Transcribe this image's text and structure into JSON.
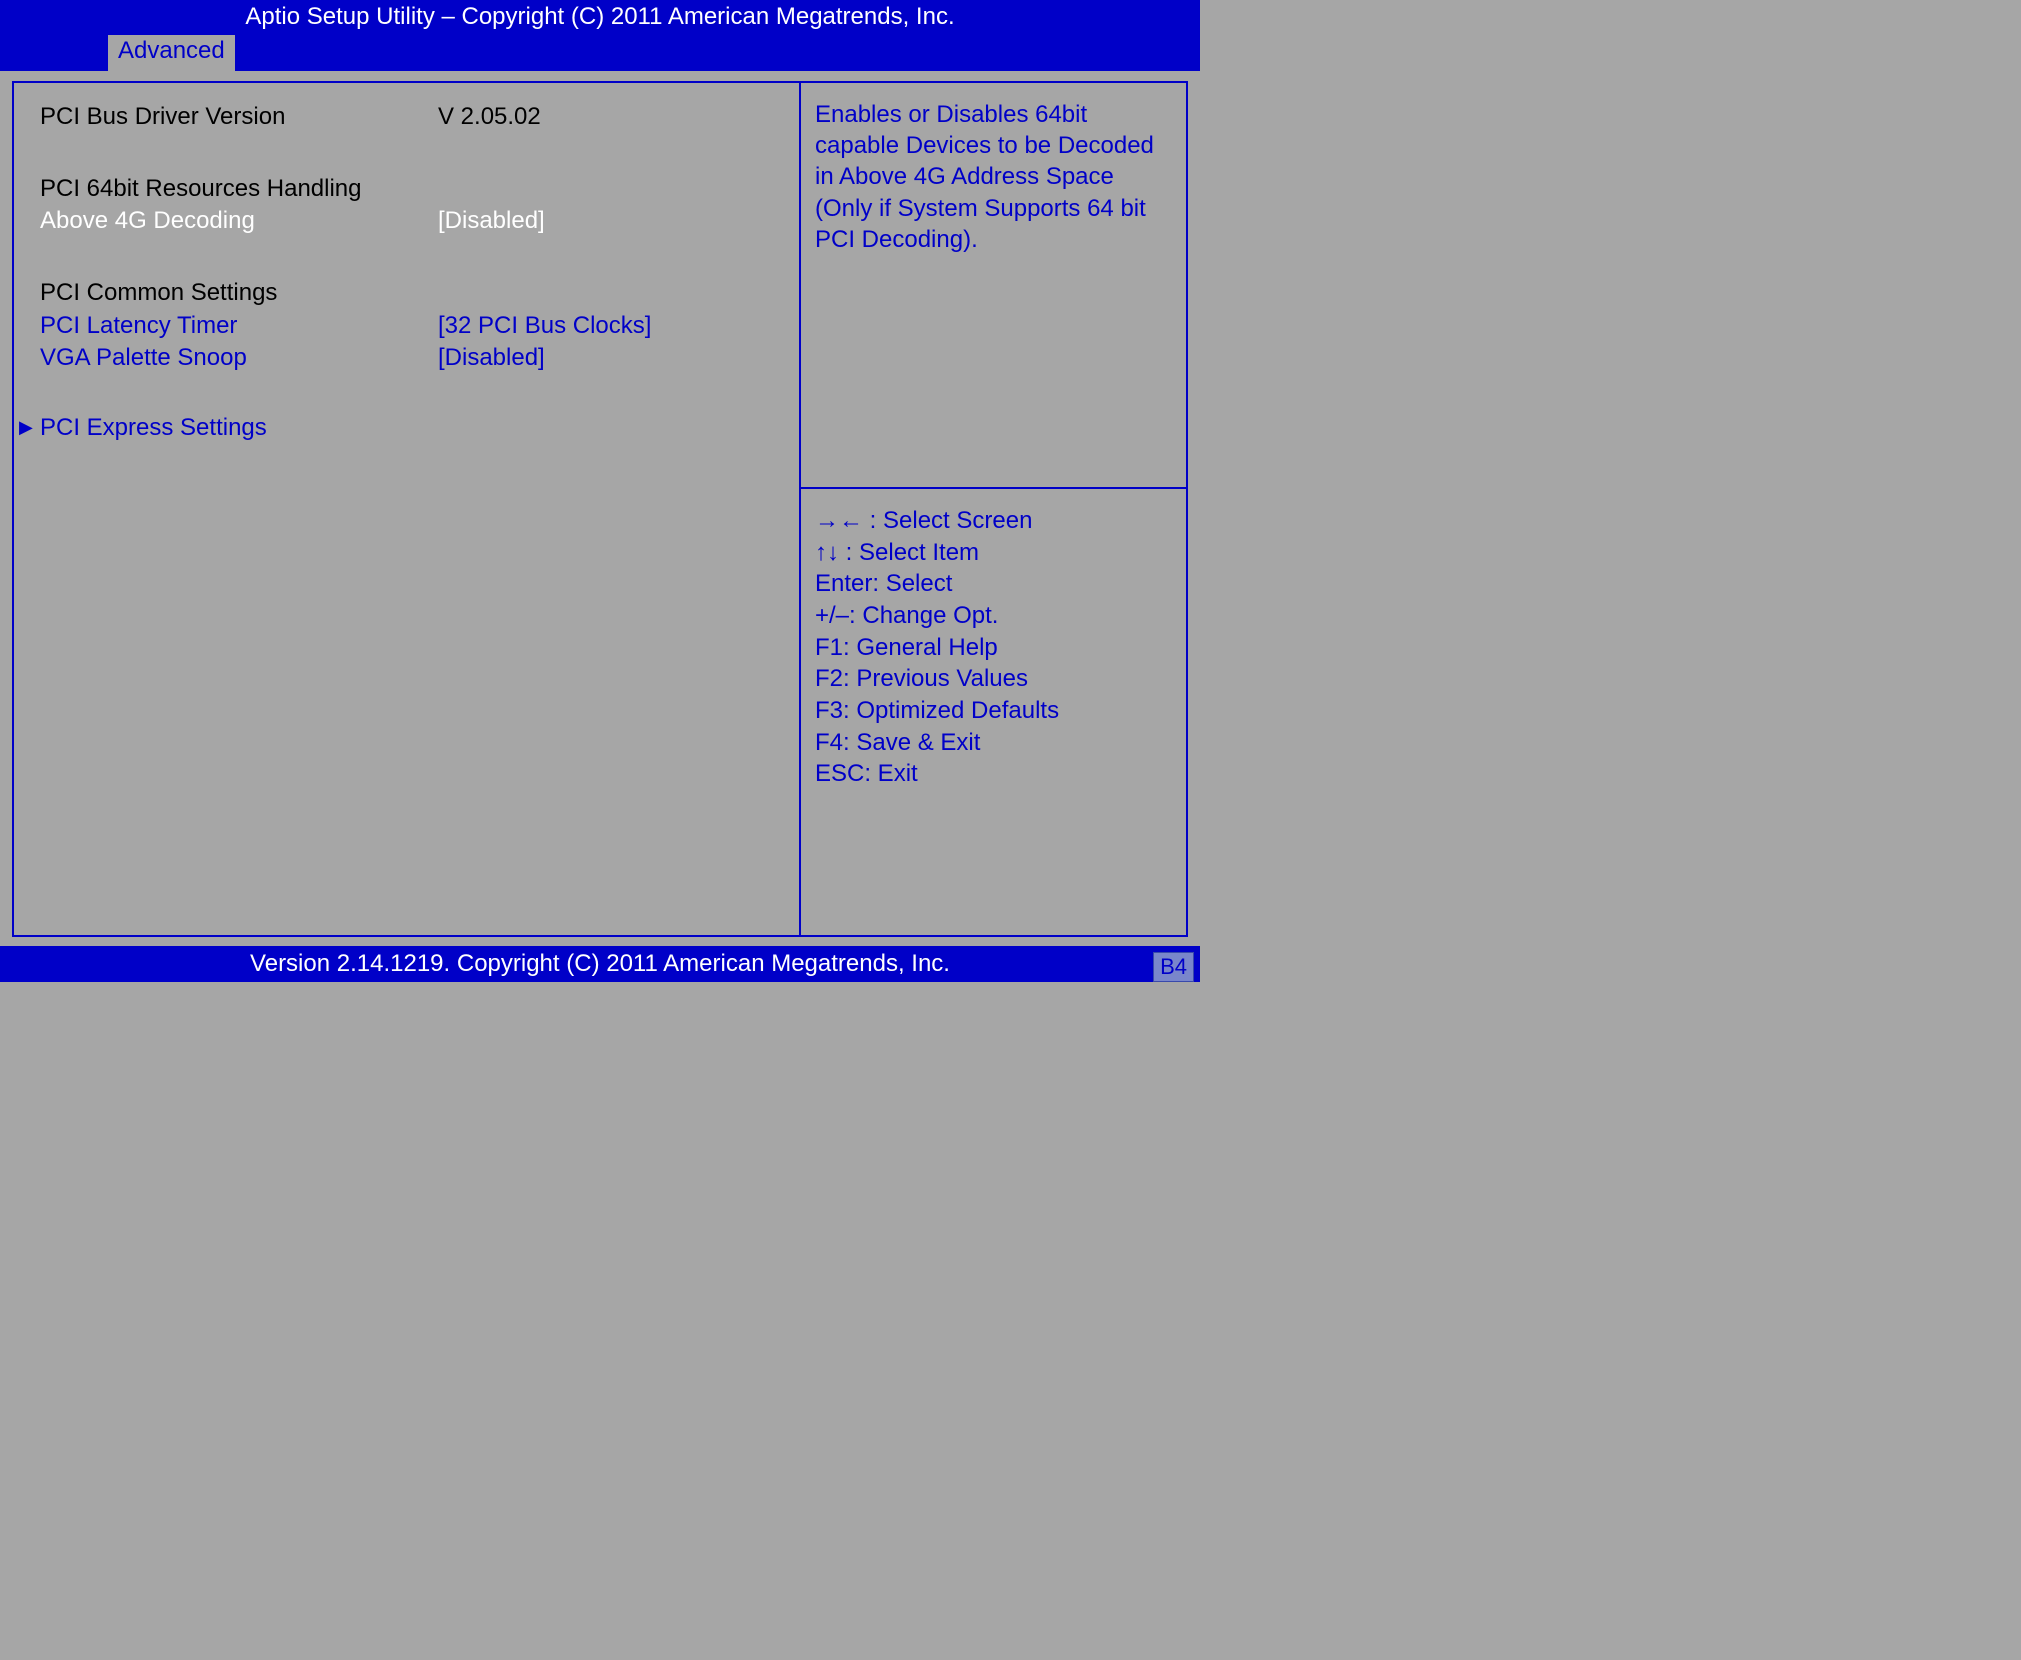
{
  "header": {
    "title": "Aptio Setup Utility – Copyright (C) 2011 American Megatrends, Inc.",
    "tab": "Advanced"
  },
  "left": {
    "bus_driver_label": "PCI Bus Driver Version",
    "bus_driver_value": "V 2.05.02",
    "section_64bit": "PCI 64bit Resources Handling",
    "above4g_label": "Above 4G Decoding",
    "above4g_value": "[Disabled]",
    "section_common": "PCI Common Settings",
    "latency_label": "PCI Latency Timer",
    "latency_value": "[32 PCI Bus Clocks]",
    "vga_label": "VGA Palette Snoop",
    "vga_value": "[Disabled]",
    "submenu": "PCI Express Settings"
  },
  "help": {
    "text": "Enables or Disables 64bit capable Devices to be Decoded in Above 4G Address Space (Only if System Supports 64 bit PCI Decoding)."
  },
  "keys": {
    "k1": "→← : Select Screen",
    "k2": "↑↓ : Select Item",
    "k3": "Enter: Select",
    "k4": "+/–: Change Opt.",
    "k5": "F1: General Help",
    "k6": "F2: Previous Values",
    "k7": "F3: Optimized Defaults",
    "k8": "F4: Save & Exit",
    "k9": "ESC: Exit"
  },
  "footer": {
    "text": "Version 2.14.1219. Copyright (C) 2011 American Megatrends, Inc.",
    "badge": "B4"
  }
}
